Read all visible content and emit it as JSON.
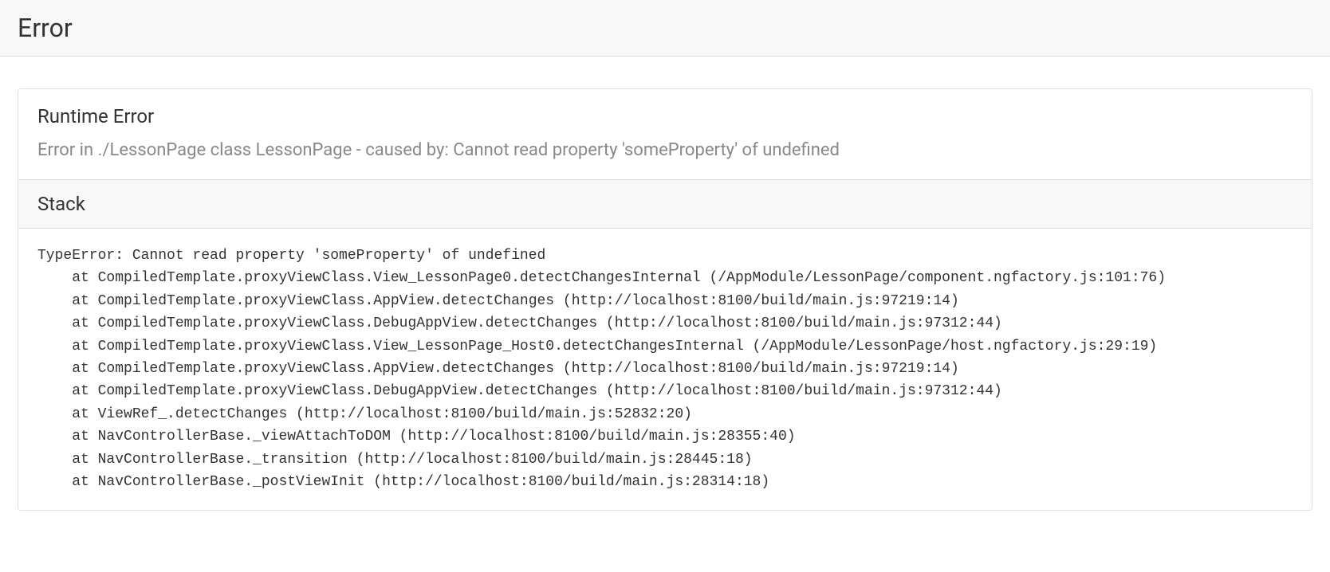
{
  "header": {
    "title": "Error"
  },
  "error": {
    "title": "Runtime Error",
    "message": "Error in ./LessonPage class LessonPage - caused by: Cannot read property 'someProperty' of undefined"
  },
  "stack": {
    "title": "Stack",
    "trace": "TypeError: Cannot read property 'someProperty' of undefined\n    at CompiledTemplate.proxyViewClass.View_LessonPage0.detectChangesInternal (/AppModule/LessonPage/component.ngfactory.js:101:76)\n    at CompiledTemplate.proxyViewClass.AppView.detectChanges (http://localhost:8100/build/main.js:97219:14)\n    at CompiledTemplate.proxyViewClass.DebugAppView.detectChanges (http://localhost:8100/build/main.js:97312:44)\n    at CompiledTemplate.proxyViewClass.View_LessonPage_Host0.detectChangesInternal (/AppModule/LessonPage/host.ngfactory.js:29:19)\n    at CompiledTemplate.proxyViewClass.AppView.detectChanges (http://localhost:8100/build/main.js:97219:14)\n    at CompiledTemplate.proxyViewClass.DebugAppView.detectChanges (http://localhost:8100/build/main.js:97312:44)\n    at ViewRef_.detectChanges (http://localhost:8100/build/main.js:52832:20)\n    at NavControllerBase._viewAttachToDOM (http://localhost:8100/build/main.js:28355:40)\n    at NavControllerBase._transition (http://localhost:8100/build/main.js:28445:18)\n    at NavControllerBase._postViewInit (http://localhost:8100/build/main.js:28314:18)"
  }
}
